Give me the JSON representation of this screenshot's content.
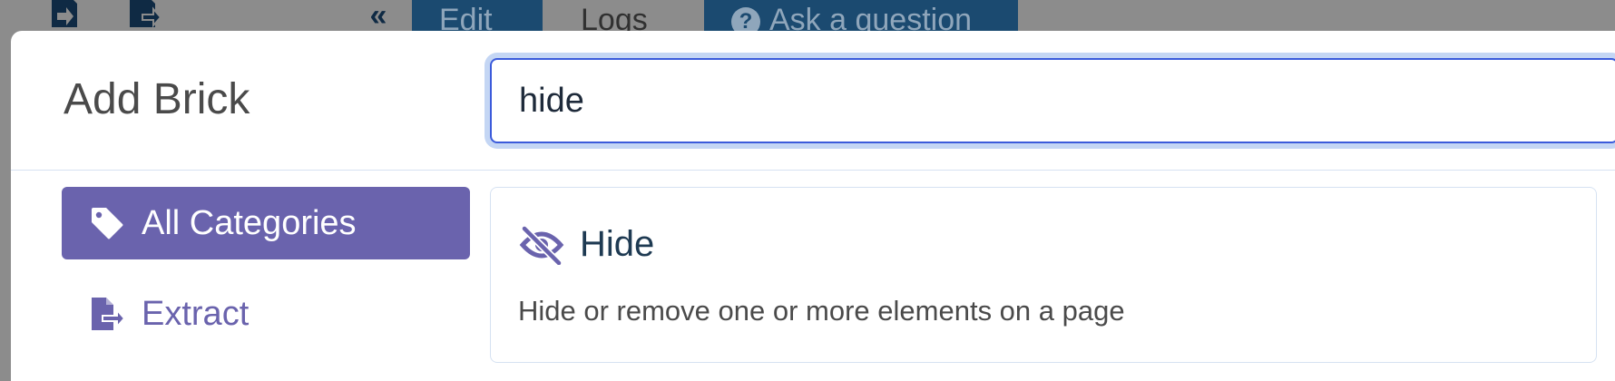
{
  "background_toolbar": {
    "collapse_glyph": "«",
    "tabs": {
      "edit": "Edit",
      "logs": "Logs",
      "ask": "Ask a question"
    },
    "icons": [
      "import-icon",
      "export-icon",
      "question-circle-icon"
    ]
  },
  "modal": {
    "title": "Add Brick",
    "search": {
      "value": "hide",
      "placeholder": ""
    },
    "categories": [
      {
        "label": "All Categories",
        "icon": "tag-icon",
        "active": true
      },
      {
        "label": "Extract",
        "icon": "file-export-icon",
        "active": false
      }
    ],
    "results": [
      {
        "title": "Hide",
        "icon": "eye-slash-icon",
        "description": "Hide or remove one or more elements on a page"
      }
    ]
  },
  "colors": {
    "accent": "#6a63ad",
    "focus_border": "#3b5bdb",
    "focus_ring": "#c4d6f4",
    "title_text": "#4a4a4a",
    "result_title": "#1e3a52",
    "bg_overlay": "#8c8c8c",
    "toolbar_navy": "#1b4a70"
  }
}
